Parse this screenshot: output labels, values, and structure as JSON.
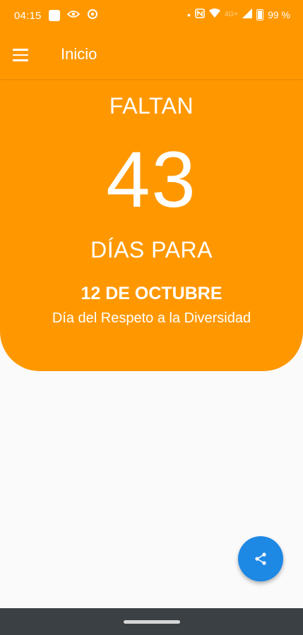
{
  "status_bar": {
    "time": "04:15",
    "network_label": "4G+",
    "battery_percent": "99 %",
    "icons": [
      "app-square-icon",
      "eye-icon",
      "sync-icon",
      "nfc-icon",
      "wifi-icon",
      "signal-icon",
      "battery-icon"
    ]
  },
  "app_bar": {
    "title": "Inicio",
    "menu_icon": "hamburger-menu-icon"
  },
  "countdown": {
    "prefix": "FALTAN",
    "days": "43",
    "suffix": "DÍAS PARA",
    "date": "12 DE OCTUBRE",
    "event": "Día del Respeto a la Diversidad"
  },
  "fab": {
    "icon": "share-icon"
  },
  "colors": {
    "primary": "#ff9800",
    "accent": "#1e88e5",
    "background": "#fafafa",
    "nav_bar": "#3b4045"
  }
}
